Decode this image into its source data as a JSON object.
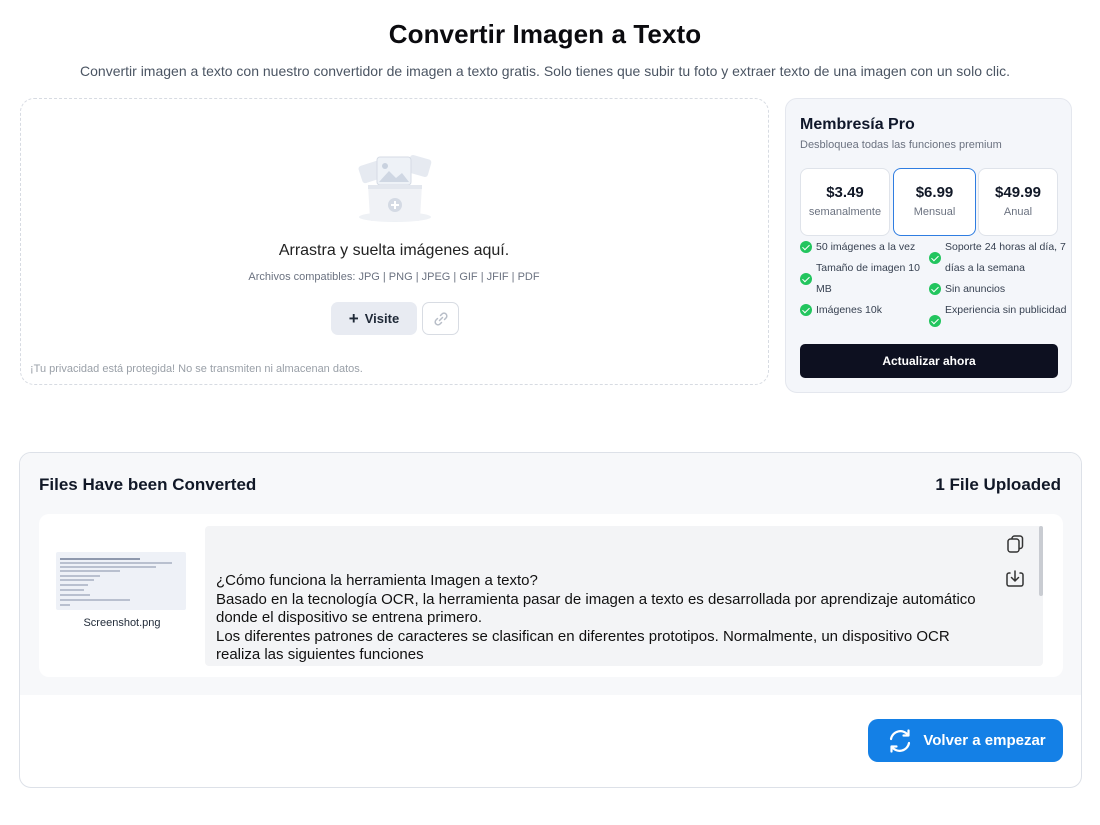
{
  "header": {
    "title": "Convertir Imagen a Texto",
    "subtitle": "Convertir imagen a texto con nuestro convertidor de imagen a texto gratis. Solo tienes que subir tu foto y extraer texto de una imagen con un solo clic."
  },
  "upload": {
    "drop_text": "Arrastra y suelta imágenes aquí.",
    "formats": "Archivos compatibles: JPG | PNG | JPEG | GIF | JFIF | PDF",
    "visit_label": "Visite",
    "privacy": "¡Tu privacidad está protegida! No se transmiten ni almacenan datos.",
    "icons": {
      "illustration": "image-upload-icon",
      "link": "link-icon",
      "plus": "plus-icon"
    }
  },
  "pro": {
    "title": "Membresía Pro",
    "subtitle": "Desbloquea todas las funciones premium",
    "plans": [
      {
        "price": "$3.49",
        "period": "semanalmente",
        "selected": false
      },
      {
        "price": "$6.99",
        "period": "Mensual",
        "selected": true
      },
      {
        "price": "$49.99",
        "period": "Anual",
        "selected": false
      }
    ],
    "features_left": [
      "50 imágenes a la vez",
      "Tamaño de imagen 10 MB",
      "Imágenes 10k"
    ],
    "features_right": [
      "Soporte 24 horas al día, 7 días a la semana",
      "Sin anuncios",
      "Experiencia sin publicidad"
    ],
    "upgrade_label": "Actualizar ahora",
    "accent_color": "#2f7de1",
    "check_color": "#22c55e"
  },
  "results": {
    "title": "Files Have been Converted",
    "count": "1 File Uploaded",
    "file": {
      "name": "Screenshot.png",
      "text_lines": [
        "¿Cómo funciona la herramienta Imagen a texto?",
        "Basado en la tecnología OCR, la herramienta pasar de imagen a texto es desarrollada por aprendizaje automático donde el dispositivo se entrena primero.",
        "Los diferentes patrones de caracteres se clasifican en diferentes prototipos. Normalmente, un dispositivo OCR realiza las siguientes funciones"
      ]
    },
    "icons": {
      "copy": "copy-icon",
      "download": "download-icon",
      "restart": "refresh-icon"
    },
    "restart_label": "Volver a empezar",
    "restart_color": "#1480e6"
  }
}
